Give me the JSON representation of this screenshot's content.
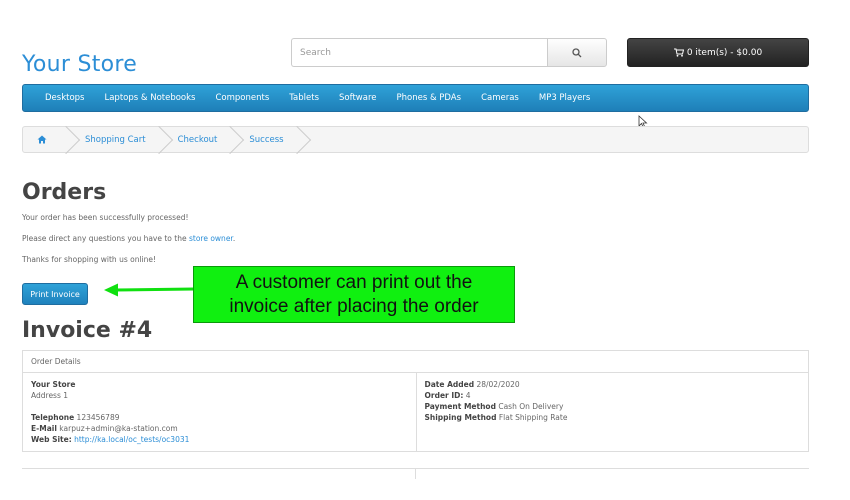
{
  "store": {
    "name": "Your Store"
  },
  "search": {
    "placeholder": "Search",
    "icon": "search-icon"
  },
  "cart": {
    "label": "0 item(s) - $0.00",
    "icon": "shopping-cart-icon"
  },
  "menu": {
    "items": [
      "Desktops",
      "Laptops & Notebooks",
      "Components",
      "Tablets",
      "Software",
      "Phones & PDAs",
      "Cameras",
      "MP3 Players"
    ]
  },
  "breadcrumb": {
    "home_icon": "home-icon",
    "items": [
      "Shopping Cart",
      "Checkout",
      "Success"
    ]
  },
  "orders": {
    "title": "Orders",
    "line1": "Your order has been successfully processed!",
    "line2_prefix": "Please direct any questions you have to the ",
    "line2_link": "store owner",
    "line2_suffix": ".",
    "line3": "Thanks for shopping with us online!",
    "print_button": "Print Invoice"
  },
  "annotation": {
    "line1": "A customer can print out the",
    "line2": "invoice after placing the order",
    "color": "#10f010"
  },
  "invoice": {
    "title": "Invoice #4",
    "header": "Order Details",
    "left": {
      "store_name": "Your Store",
      "address": "Address 1",
      "telephone_label": "Telephone",
      "telephone": "123456789",
      "email_label": "E-Mail",
      "email": "karpuz+admin@ka-station.com",
      "website_label": "Web Site:",
      "website": "http://ka.local/oc_tests/oc3031"
    },
    "right": {
      "date_label": "Date Added",
      "date": "28/02/2020",
      "order_id_label": "Order ID:",
      "order_id": "4",
      "payment_label": "Payment Method",
      "payment": "Cash On Delivery",
      "shipping_label": "Shipping Method",
      "shipping": "Flat Shipping Rate"
    }
  },
  "colors": {
    "accent": "#2c8ed6",
    "menu": "#2293cc",
    "cart": "#333333"
  }
}
